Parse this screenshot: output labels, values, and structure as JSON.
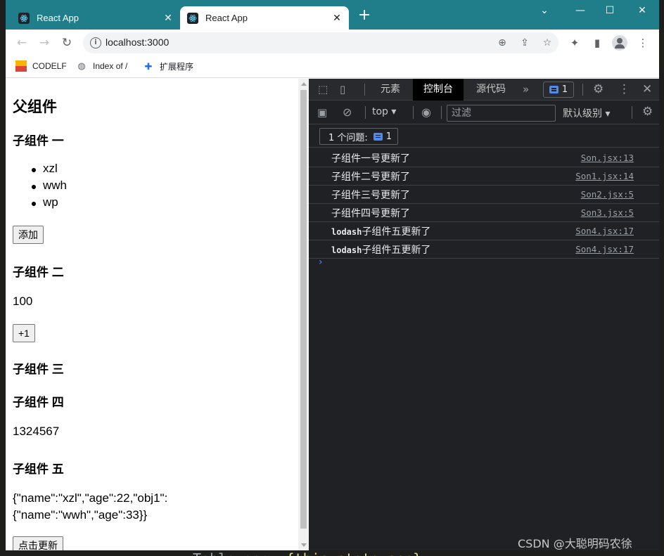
{
  "browser": {
    "tabs": [
      {
        "title": "React App",
        "active": false
      },
      {
        "title": "React App",
        "active": true
      }
    ],
    "url": "localhost:3000",
    "bookmarks": [
      "CODELF",
      "Index of /",
      "扩展程序"
    ],
    "accent": "#1f7e8a"
  },
  "page": {
    "parent_title": "父组件",
    "child1": {
      "title": "子组件 一",
      "items": [
        "xzl",
        "wwh",
        "wp"
      ],
      "button": "添加"
    },
    "child2": {
      "title": "子组件 二",
      "value": "100",
      "button": "+1"
    },
    "child3": {
      "title": "子组件 三"
    },
    "child4": {
      "title": "子组件 四",
      "value": "1324567"
    },
    "child5": {
      "title": "子组件 五",
      "json_line1": "{\"name\":\"xzl\",\"age\":22,\"obj1\":",
      "json_line2": "{\"name\":\"wwh\",\"age\":33}}",
      "button": "点击更新"
    }
  },
  "devtools": {
    "tabs": [
      "元素",
      "控制台",
      "源代码"
    ],
    "active_tab": "控制台",
    "issue_badge": "1",
    "context": "top",
    "filter_placeholder": "过滤",
    "level": "默认级别",
    "issues_label": "1 个问题:",
    "issues_count": "1",
    "console": [
      {
        "prefix": "",
        "text": "子组件一号更新了",
        "source": "Son.jsx:13"
      },
      {
        "prefix": "",
        "text": "子组件二号更新了",
        "source": "Son1.jsx:14"
      },
      {
        "prefix": "",
        "text": "子组件三号更新了",
        "source": "Son2.jsx:5"
      },
      {
        "prefix": "",
        "text": "子组件四号更新了",
        "source": "Son3.jsx:5"
      },
      {
        "prefix": "lodash",
        "text": "子组件五更新了",
        "source": "Son4.jsx:17"
      },
      {
        "prefix": "lodash",
        "text": "子组件五更新了",
        "source": "Son4.jsx:17"
      }
    ]
  },
  "watermark": "CSDN @大聪明码农徐"
}
